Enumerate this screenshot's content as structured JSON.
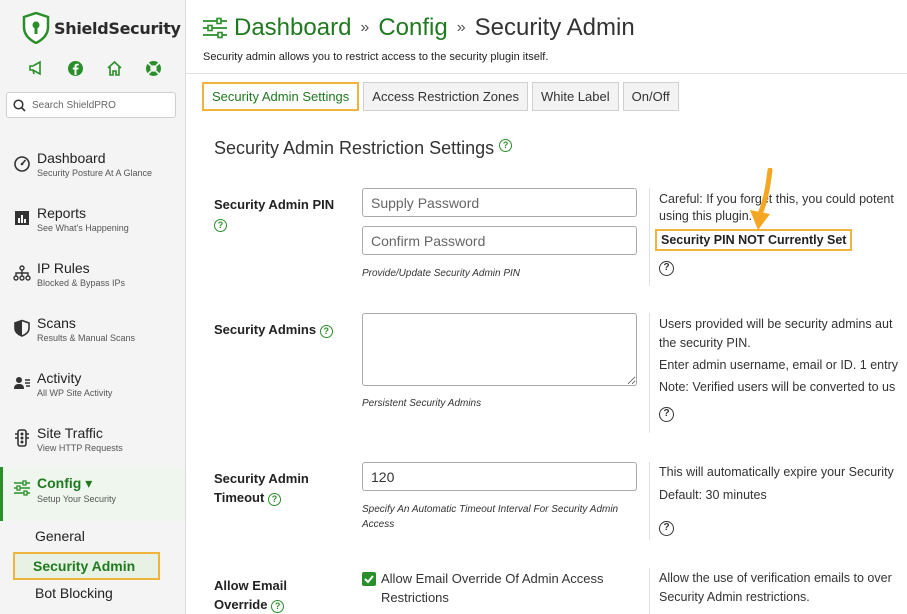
{
  "brand": {
    "name": "ShieldSecurity"
  },
  "social_icons": [
    "megaphone-icon",
    "facebook-icon",
    "home-icon",
    "lifebuoy-icon"
  ],
  "search": {
    "placeholder": "Search ShieldPRO"
  },
  "sidebar": {
    "items": [
      {
        "title": "Dashboard",
        "subtitle": "Security Posture At A Glance",
        "icon": "gauge-icon"
      },
      {
        "title": "Reports",
        "subtitle": "See What's Happening",
        "icon": "reports-icon"
      },
      {
        "title": "IP Rules",
        "subtitle": "Blocked & Bypass IPs",
        "icon": "network-icon"
      },
      {
        "title": "Scans",
        "subtitle": "Results & Manual Scans",
        "icon": "shield-half-icon"
      },
      {
        "title": "Activity",
        "subtitle": "All WP Site Activity",
        "icon": "users-icon"
      },
      {
        "title": "Site Traffic",
        "subtitle": "View HTTP Requests",
        "icon": "traffic-icon"
      },
      {
        "title": "Config ▾",
        "subtitle": "Setup Your Security",
        "icon": "sliders-icon"
      }
    ],
    "sub_items": [
      "General",
      "Security Admin",
      "Bot Blocking"
    ]
  },
  "breadcrumb": {
    "part1": "Dashboard",
    "part2": "Config",
    "current": "Security Admin",
    "separator": "»"
  },
  "page_description": "Security admin allows you to restrict access to the security plugin itself.",
  "tabs": [
    "Security Admin Settings",
    "Access Restriction Zones",
    "White Label",
    "On/Off"
  ],
  "section_title": "Security Admin Restriction Settings",
  "settings": {
    "pin": {
      "label": "Security Admin PIN",
      "placeholder_password": "Supply Password",
      "placeholder_confirm": "Confirm Password",
      "hint": "Provide/Update Security Admin PIN",
      "desc_line1": "Careful: If you forget this, you could potent",
      "desc_line2": "using this plugin.",
      "status": "Security PIN NOT Currently Set"
    },
    "admins": {
      "label": "Security Admins",
      "hint": "Persistent Security Admins",
      "desc_line1": "Users provided will be security admins aut",
      "desc_line2": "the security PIN.",
      "desc_line3": "Enter admin username, email or ID. 1 entry",
      "desc_line4": "Note: Verified users will be converted to us"
    },
    "timeout": {
      "label_line1": "Security Admin",
      "label_line2": "Timeout",
      "value": "120",
      "hint": "Specify An Automatic Timeout Interval For Security Admin Access",
      "desc_line1": "This will automatically expire your Security",
      "desc_line2": "Default: 30 minutes"
    },
    "email_override": {
      "label_line1": "Allow Email",
      "label_line2": "Override",
      "checkbox_label": "Allow Email Override Of Admin Access Restrictions",
      "checked": true,
      "desc_line1": "Allow the use of verification emails to over",
      "desc_line2": "Security Admin restrictions."
    }
  },
  "colors": {
    "accent": "#1f7a1f",
    "highlight": "#f0b43c",
    "arrow": "#f5a623"
  }
}
